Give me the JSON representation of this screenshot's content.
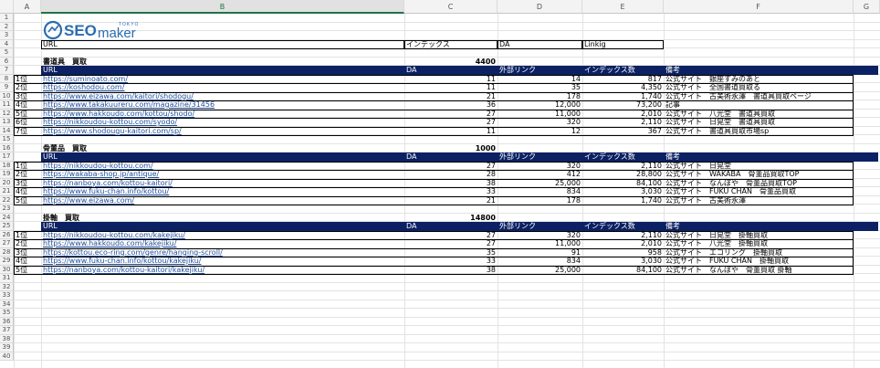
{
  "columns": [
    "A",
    "B",
    "C",
    "D",
    "E",
    "F",
    "G"
  ],
  "logo": {
    "text_seo": "SEO",
    "text_maker": "maker",
    "text_tokyo": "TOKYO",
    "color": "#2b6cb0"
  },
  "top_header": {
    "url": "URL",
    "index": "インデックス",
    "da": "DA",
    "linkig": "Linkig"
  },
  "table_headers": {
    "url": "URL",
    "da": "DA",
    "external": "外部リンク",
    "index_count": "インデックス数",
    "note": "備考"
  },
  "sections": [
    {
      "title": "書道具　買取",
      "volume": "4400",
      "rows": [
        {
          "rank": "1位",
          "url": "https://suminoato.com/",
          "da": "11",
          "ext": "14",
          "idx": "817",
          "note": "公式サイト　銀座すみのあと"
        },
        {
          "rank": "2位",
          "url": "https://koshodou.com/",
          "da": "11",
          "ext": "35",
          "idx": "4,350",
          "note": "公式サイト　全国書道買取る"
        },
        {
          "rank": "3位",
          "url": "https://www.eizawa.com/kaitori/shodogu/",
          "da": "21",
          "ext": "178",
          "idx": "1,740",
          "note": "公式サイト　古美術永澤　書道具買取ページ"
        },
        {
          "rank": "4位",
          "url": "https://www.takakuureru.com/magazine/31456",
          "da": "36",
          "ext": "12,000",
          "idx": "73,200",
          "note": "記事"
        },
        {
          "rank": "5位",
          "url": "https://www.hakkoudo.com/kottou/shodo/",
          "da": "27",
          "ext": "11,000",
          "idx": "2,010",
          "note": "公式サイト　八光堂　書道具買取"
        },
        {
          "rank": "6位",
          "url": "https://nikkoudou-kottou.com/syodo/",
          "da": "27",
          "ext": "320",
          "idx": "2,110",
          "note": "公式サイト　日晃堂　書道具買取"
        },
        {
          "rank": "7位",
          "url": "https://www.shodougu-kaitori.com/sp/",
          "da": "11",
          "ext": "12",
          "idx": "367",
          "note": "公式サイト　書道具買取市場sp"
        }
      ]
    },
    {
      "title": "骨董品　買取",
      "volume": "1000",
      "rows": [
        {
          "rank": "1位",
          "url": "https://nikkoudou-kottou.com/",
          "da": "27",
          "ext": "320",
          "idx": "2,110",
          "note": "公式サイト　日晃堂"
        },
        {
          "rank": "2位",
          "url": "https://wakaba-shop.jp/antique/",
          "da": "28",
          "ext": "412",
          "idx": "28,800",
          "note": "公式サイト　WAKABA　骨董品買取TOP"
        },
        {
          "rank": "3位",
          "url": "https://nanboya.com/kottou-kaitori/",
          "da": "38",
          "ext": "25,000",
          "idx": "84,100",
          "note": "公式サイト　なんぼや　骨董品買取TOP"
        },
        {
          "rank": "4位",
          "url": "https://www.fuku-chan.info/kottou/",
          "da": "33",
          "ext": "834",
          "idx": "3,030",
          "note": "公式サイト　FUKU CHAN　骨董品買取"
        },
        {
          "rank": "5位",
          "url": "https://www.eizawa.com/",
          "da": "21",
          "ext": "178",
          "idx": "1,740",
          "note": "公式サイト　古美術永澤"
        }
      ]
    },
    {
      "title": "掛軸　買取",
      "volume": "14800",
      "rows": [
        {
          "rank": "1位",
          "url": "https://nikkoudou-kottou.com/kakejiku/",
          "da": "27",
          "ext": "320",
          "idx": "2,110",
          "note": "公式サイト　日晃堂　掛軸買取"
        },
        {
          "rank": "2位",
          "url": "https://www.hakkoudo.com/kakejiku/",
          "da": "27",
          "ext": "11,000",
          "idx": "2,010",
          "note": "公式サイト　八光堂　掛軸買取"
        },
        {
          "rank": "3位",
          "url": "https://kottou.eco-ring.com/genre/hanging-scroll/",
          "da": "35",
          "ext": "91",
          "idx": "958",
          "note": "公式サイト　エコリング　掛軸買取"
        },
        {
          "rank": "4位",
          "url": "https://www.fuku-chan.info/kottou/kakejiku/",
          "da": "33",
          "ext": "834",
          "idx": "3,030",
          "note": "公式サイト　FUKU CHAN　掛軸買取"
        },
        {
          "rank": "5位",
          "url": "https://nanboya.com/kottou-kaitori/kakejiku/",
          "da": "38",
          "ext": "25,000",
          "idx": "84,100",
          "note": "公式サイト　なんぼや　骨董買取 掛軸"
        }
      ]
    }
  ]
}
